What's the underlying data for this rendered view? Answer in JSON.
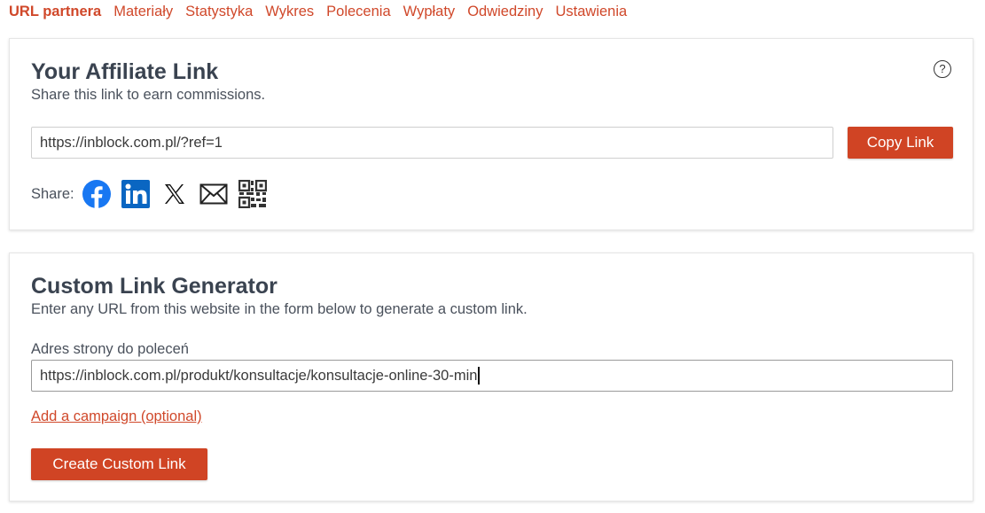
{
  "nav": {
    "items": [
      {
        "label": "URL partnera",
        "active": true
      },
      {
        "label": "Materiały"
      },
      {
        "label": "Statystyka"
      },
      {
        "label": "Wykres"
      },
      {
        "label": "Polecenia"
      },
      {
        "label": "Wypłaty"
      },
      {
        "label": "Odwiedziny"
      },
      {
        "label": "Ustawienia"
      }
    ]
  },
  "affiliate": {
    "title": "Your Affiliate Link",
    "subtitle": "Share this link to earn commissions.",
    "help_icon": "question-circle-icon",
    "link_value": "https://inblock.com.pl/?ref=1",
    "copy_label": "Copy Link",
    "share_label": "Share:",
    "share_icons": [
      "facebook-icon",
      "linkedin-icon",
      "x-icon",
      "email-icon",
      "qr-code-icon"
    ]
  },
  "generator": {
    "title": "Custom Link Generator",
    "subtitle": "Enter any URL from this website in the form below to generate a custom link.",
    "field_label": "Adres strony do poleceń",
    "url_value": "https://inblock.com.pl/produkt/konsultacje/konsultacje-online-30-min",
    "campaign_link": "Add a campaign (optional)",
    "create_label": "Create Custom Link"
  },
  "colors": {
    "accent": "#d04424",
    "link": "#d0482a",
    "facebook": "#1877f2",
    "linkedin": "#0a66c2"
  }
}
